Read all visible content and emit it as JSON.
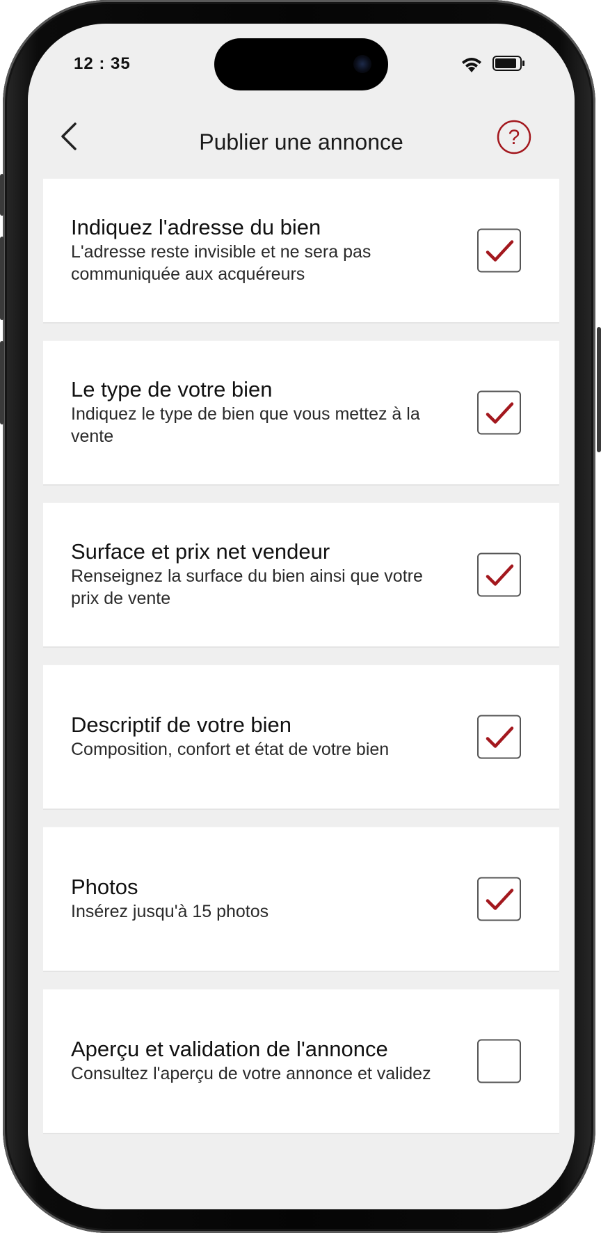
{
  "status_bar": {
    "time": "12 : 35"
  },
  "header": {
    "title": "Publier une annonce",
    "help_label": "?"
  },
  "colors": {
    "accent": "#a3181e",
    "background": "#efefef",
    "card": "#ffffff"
  },
  "steps": [
    {
      "title": "Indiquez l'adresse du bien",
      "description": "L'adresse reste invisible et ne sera pas communiquée aux acquéreurs",
      "checked": true
    },
    {
      "title": "Le type de votre bien",
      "description": "Indiquez le type de bien que vous mettez à la vente",
      "checked": true
    },
    {
      "title": "Surface et prix net vendeur",
      "description": "Renseignez la surface du bien ainsi que votre prix de vente",
      "checked": true
    },
    {
      "title": "Descriptif de votre bien",
      "description": "Composition, confort et état de votre bien",
      "checked": true
    },
    {
      "title": "Photos",
      "description": "Insérez jusqu'à 15 photos",
      "checked": true
    },
    {
      "title": "Aperçu et validation de l'annonce",
      "description": "Consultez l'aperçu de votre annonce et validez",
      "checked": false
    }
  ]
}
